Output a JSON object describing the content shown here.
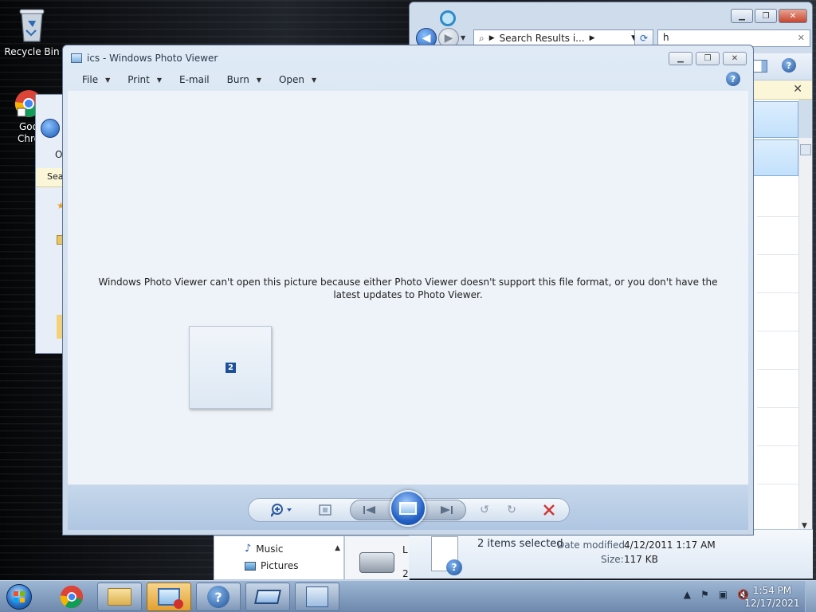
{
  "desktop": {
    "icons": [
      {
        "label": "Recycle Bin"
      },
      {
        "label": "Goo\nChro"
      }
    ]
  },
  "explorer": {
    "address": "Search Results i...",
    "search_value": "h",
    "close_glyph": "✕",
    "nav_tree": [
      "Music",
      "Pictures"
    ],
    "details": {
      "selected": "2 items selected",
      "date_label": "Date modified:",
      "date_value": "4/12/2011 1:17 AM",
      "size_label": "Size:",
      "size_value": "117 KB"
    },
    "partial_labels": [
      "L",
      "2"
    ]
  },
  "left_window": {
    "partial_label": "Sea",
    "partial_o": "O"
  },
  "photo_viewer": {
    "title": "ics - Windows Photo Viewer",
    "menu": [
      "File",
      "Print",
      "E-mail",
      "Burn",
      "Open"
    ],
    "message": "Windows Photo Viewer can't open this picture because either Photo Viewer doesn't support this file format, or you don't have the latest updates to Photo Viewer.",
    "thumbnail_badge": "2"
  },
  "taskbar": {
    "time": "1:54 PM",
    "date": "12/17/2021"
  },
  "colors": {
    "accent": "#2462c7",
    "delete": "#d0312d"
  }
}
